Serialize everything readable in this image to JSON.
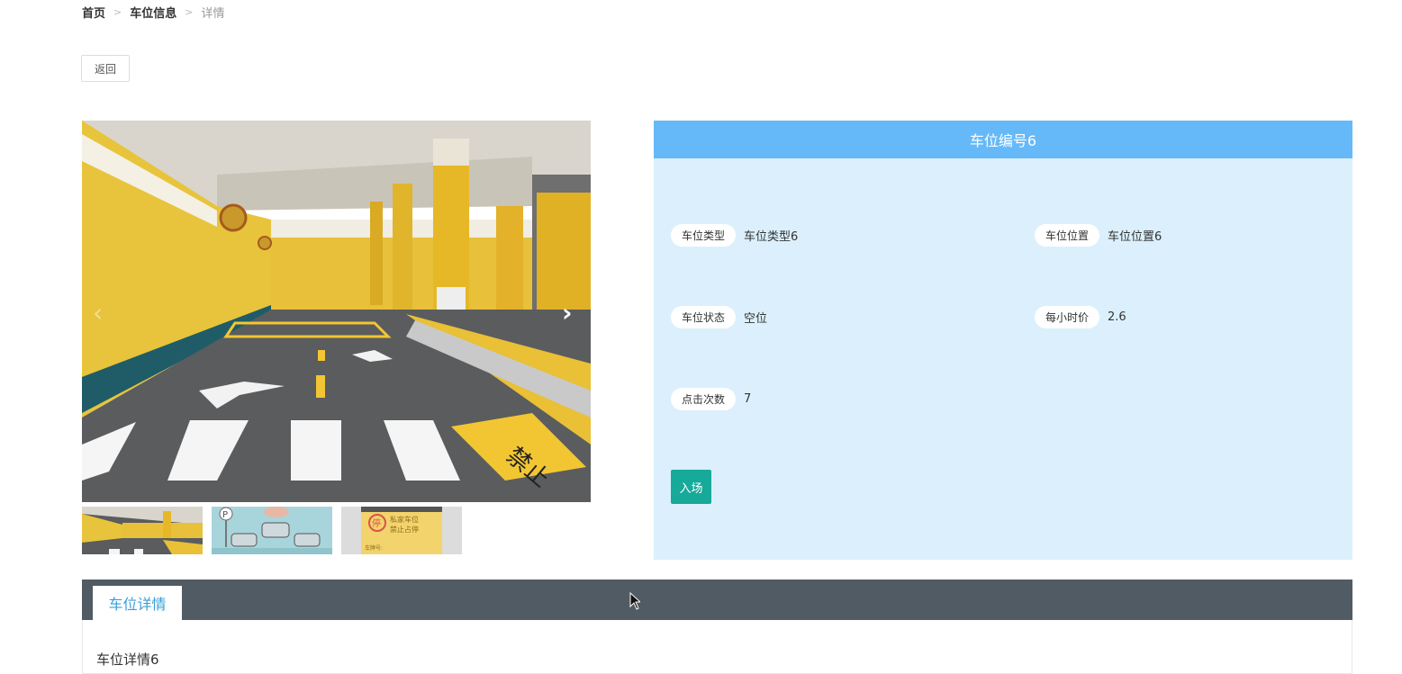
{
  "breadcrumb": {
    "home": "首页",
    "sep": ">",
    "section": "车位信息",
    "current": "详情"
  },
  "back_label": "返回",
  "gallery": {
    "prev_icon": "‹",
    "next_icon": "›",
    "thumbnails": [
      "parking-garage-photo",
      "parking-illustration",
      "private-parking-sign"
    ],
    "thumb_sign": {
      "badge": "停",
      "line1": "私家车位",
      "line2": "禁止占停",
      "plate": "车牌号:"
    }
  },
  "info": {
    "title": "车位编号6",
    "fields": {
      "type": {
        "label": "车位类型",
        "value": "车位类型6"
      },
      "location": {
        "label": "车位位置",
        "value": "车位位置6"
      },
      "status": {
        "label": "车位状态",
        "value": "空位"
      },
      "price": {
        "label": "每小时价",
        "value": "2.6"
      },
      "clicks": {
        "label": "点击次数",
        "value": "7"
      }
    },
    "enter_label": "入场"
  },
  "tabs": {
    "active_label": "车位详情",
    "content": "车位详情6"
  },
  "colors": {
    "header_blue": "#66b9f8",
    "panel_bg": "#dbf0fc",
    "enter_green": "#17a99a",
    "tab_bar": "#515b63",
    "tab_text": "#3a9ed8"
  }
}
